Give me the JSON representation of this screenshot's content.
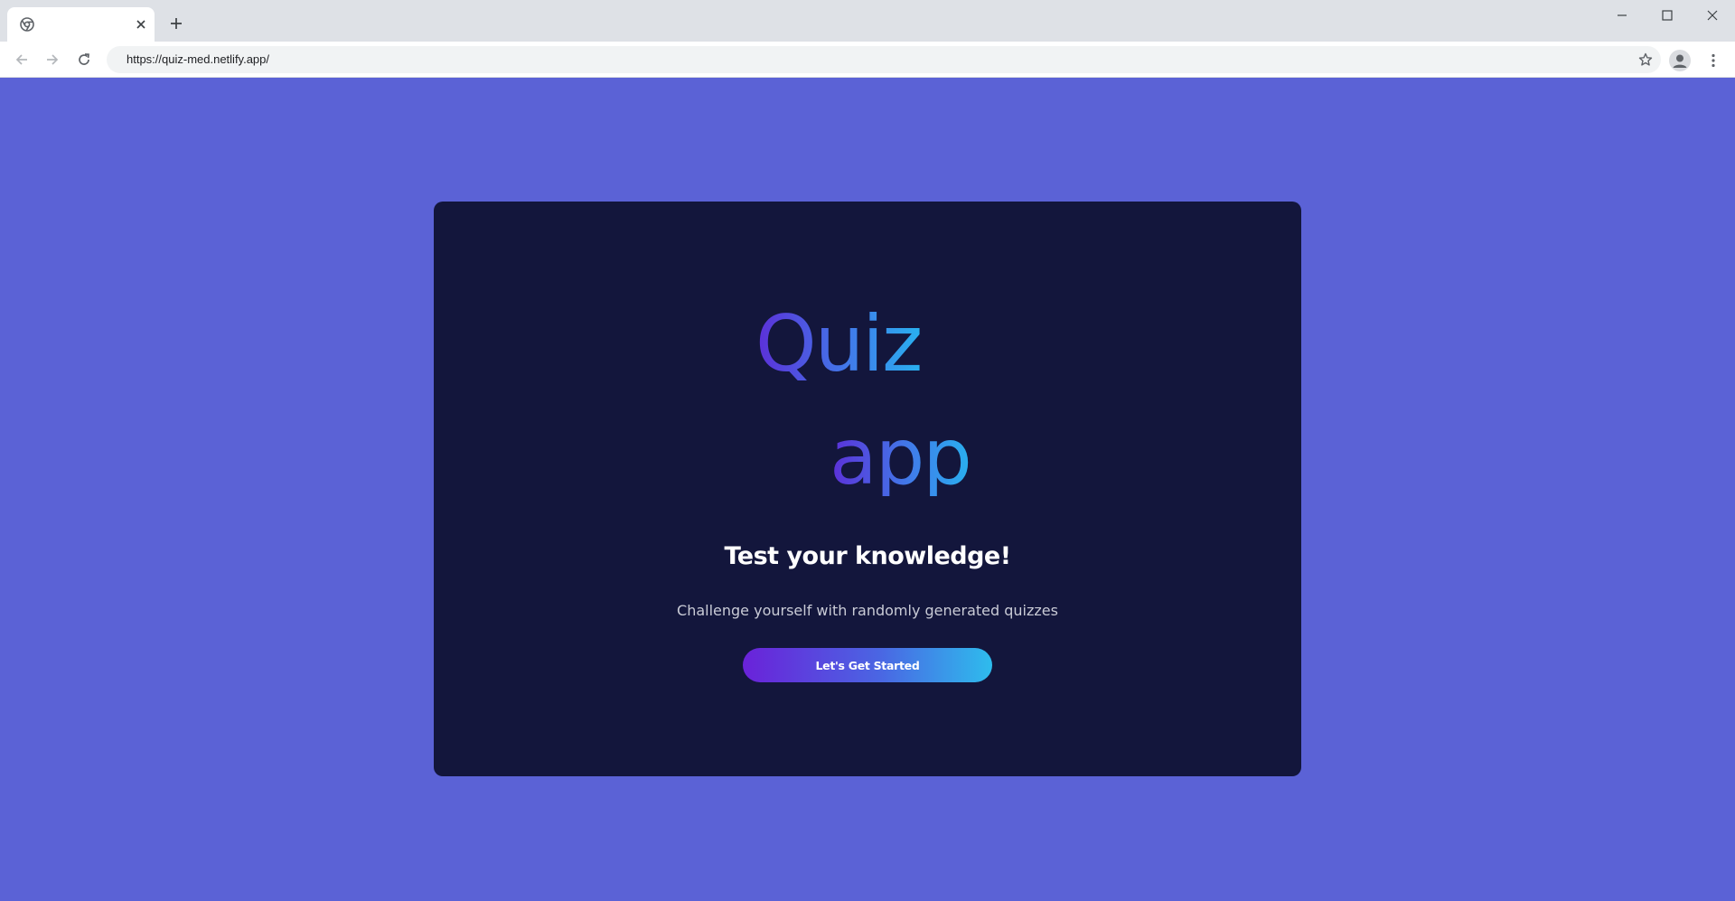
{
  "browser": {
    "tab": {
      "title": "",
      "close_label": "×"
    },
    "new_tab_label": "+",
    "url": "https://quiz-med.netlify.app/"
  },
  "page": {
    "background_color": "#5b62d6",
    "card_color": "#13163c",
    "logo": {
      "line1": "Quiz",
      "line2": "app"
    },
    "headline": "Test your knowledge!",
    "subline": "Challenge yourself with randomly generated quizzes",
    "cta_label": "Let's Get Started"
  }
}
